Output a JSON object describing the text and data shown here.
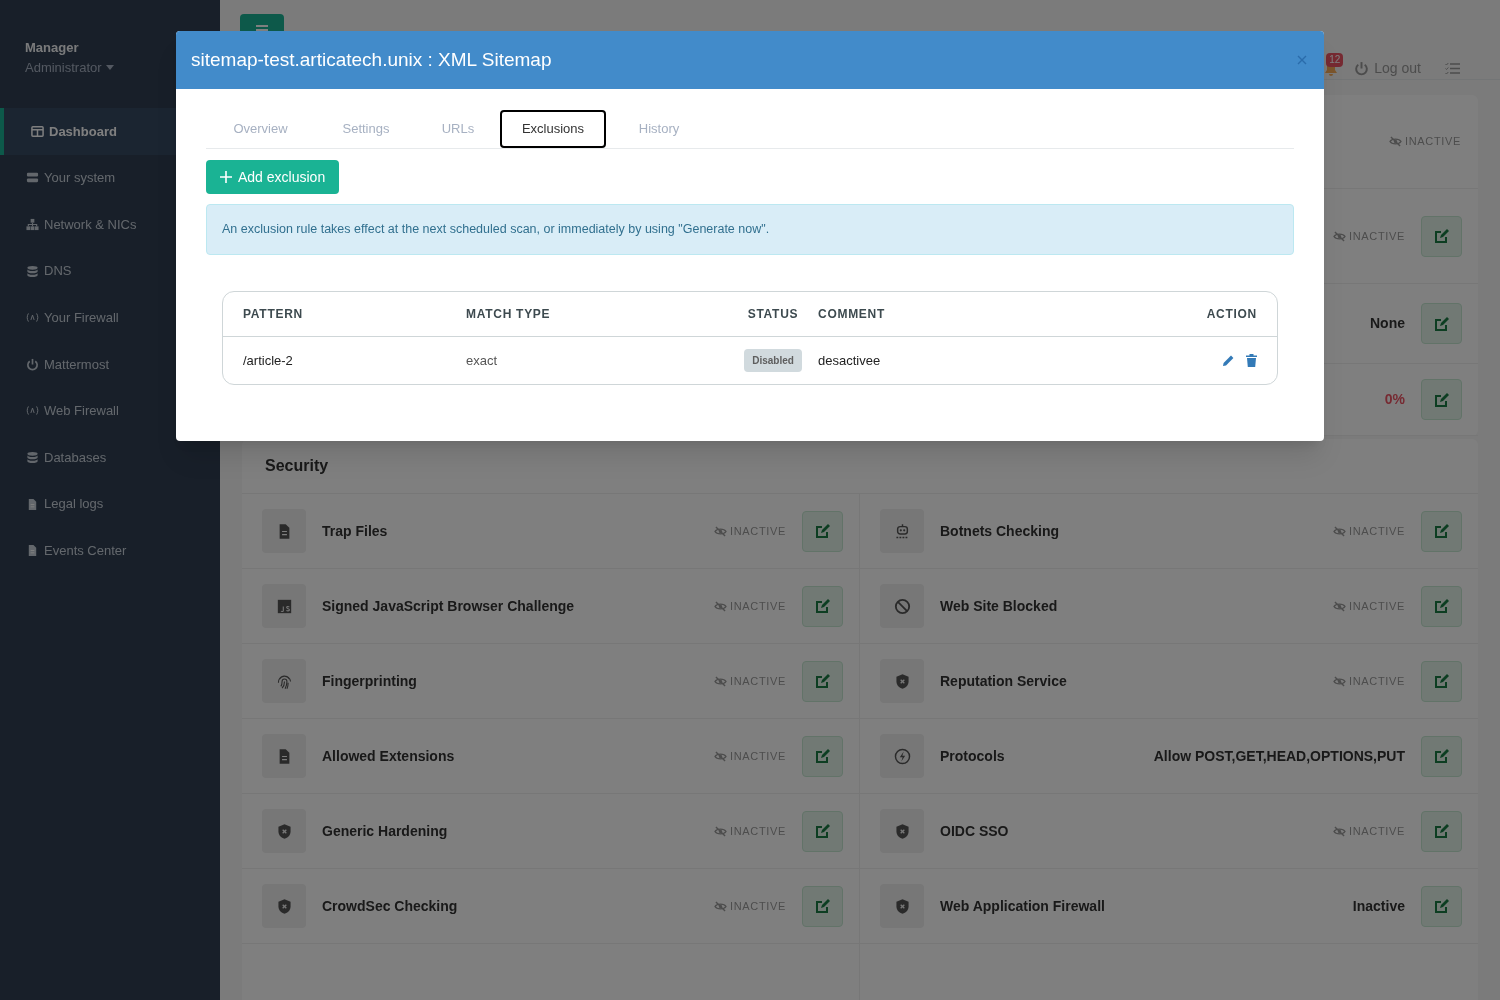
{
  "sidebar": {
    "user": {
      "name": "Manager",
      "role": "Administrator"
    },
    "items": [
      {
        "label": "Dashboard",
        "selected": true
      },
      {
        "label": "Your system",
        "selected": false
      },
      {
        "label": "Network & NICs",
        "selected": false
      },
      {
        "label": "DNS",
        "selected": false
      },
      {
        "label": "Your Firewall",
        "selected": false
      },
      {
        "label": "Mattermost",
        "selected": false
      },
      {
        "label": "Web Firewall",
        "selected": false
      },
      {
        "label": "Databases",
        "selected": false
      },
      {
        "label": "Legal logs",
        "selected": false
      },
      {
        "label": "Events Center",
        "selected": false
      }
    ]
  },
  "header": {
    "notification_count": "12",
    "logout": "Log out"
  },
  "overview_rows": [
    {
      "status": "INACTIVE",
      "kind": "inactive",
      "editable": false
    },
    {
      "status": "INACTIVE",
      "kind": "inactive",
      "editable": true
    },
    {
      "status": "None",
      "kind": "value",
      "editable": true
    },
    {
      "status": "0%",
      "kind": "alert",
      "editable": true
    }
  ],
  "security": {
    "title": "Security",
    "items": [
      {
        "label": "Trap Files",
        "status": "INACTIVE",
        "kind": "inactive"
      },
      {
        "label": "Botnets Checking",
        "status": "INACTIVE",
        "kind": "inactive"
      },
      {
        "label": "Signed JavaScript Browser Challenge",
        "status": "INACTIVE",
        "kind": "inactive"
      },
      {
        "label": "Web Site Blocked",
        "status": "INACTIVE",
        "kind": "inactive"
      },
      {
        "label": "Fingerprinting",
        "status": "INACTIVE",
        "kind": "inactive"
      },
      {
        "label": "Reputation Service",
        "status": "INACTIVE",
        "kind": "inactive"
      },
      {
        "label": "Allowed Extensions",
        "status": "INACTIVE",
        "kind": "inactive"
      },
      {
        "label": "Protocols",
        "status": "Allow POST,GET,HEAD,OPTIONS,PUT",
        "kind": "value"
      },
      {
        "label": "Generic Hardening",
        "status": "INACTIVE",
        "kind": "inactive"
      },
      {
        "label": "OIDC SSO",
        "status": "INACTIVE",
        "kind": "inactive"
      },
      {
        "label": "CrowdSec Checking",
        "status": "INACTIVE",
        "kind": "inactive"
      },
      {
        "label": "Web Application Firewall",
        "status": "Inactive",
        "kind": "value"
      }
    ]
  },
  "modal": {
    "title": "sitemap-test.articatech.unix : XML Sitemap",
    "tabs": [
      {
        "label": "Overview",
        "selected": false
      },
      {
        "label": "Settings",
        "selected": false
      },
      {
        "label": "URLs",
        "selected": false
      },
      {
        "label": "Exclusions",
        "selected": true
      },
      {
        "label": "History",
        "selected": false
      }
    ],
    "add_button": "Add exclusion",
    "notice": "An exclusion rule takes effect at the next scheduled scan, or immediately by using \"Generate now\".",
    "table": {
      "columns": [
        "PATTERN",
        "MATCH TYPE",
        "STATUS",
        "COMMENT",
        "ACTION"
      ],
      "rows": [
        {
          "pattern": "/article-2",
          "match_type": "exact",
          "status": "Disabled",
          "enabled": false,
          "comment": "desactivee"
        }
      ]
    }
  }
}
